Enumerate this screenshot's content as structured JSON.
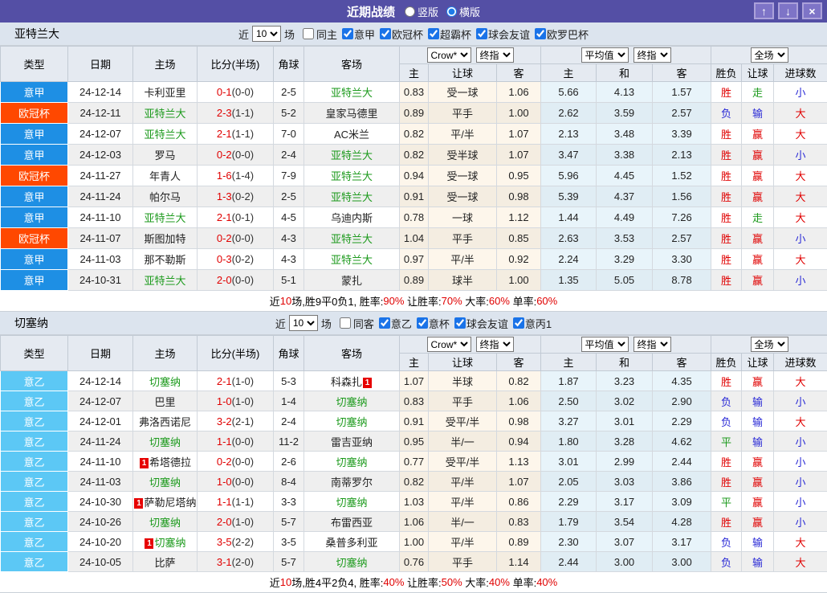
{
  "titlebar": {
    "title": "近期战绩",
    "view_options": [
      {
        "label": "竖版",
        "selected": false
      },
      {
        "label": "横版",
        "selected": true
      }
    ],
    "buttons": {
      "up": "↑",
      "down": "↓",
      "close": "×"
    }
  },
  "colors": {
    "titlebar_bg": "#544fa5",
    "button_bg": "#7e74c7",
    "button_border": "#aba1da",
    "filterbar_bg": "#dce4ee",
    "header_bg": "#e5eaf1",
    "league_blue": "#1e8fe4",
    "league_orange": "#ff4800",
    "league_sky": "#5cc8f5",
    "crow_bg": "#fdf6eb",
    "avg_bg": "#e8f4fa",
    "row_alt": "#efefef",
    "red": "#e00000",
    "green": "#1c9a1c",
    "blue": "#2929d6",
    "team_green": "#1c9a1c",
    "badge_bg": "#e60000"
  },
  "result_colors": {
    "胜": "red",
    "平": "green",
    "负": "blue",
    "赢": "red",
    "走": "green",
    "输": "blue",
    "大": "red",
    "小": "blue"
  },
  "table_header": {
    "cols": [
      "类型",
      "日期",
      "主场",
      "比分(半场)",
      "角球",
      "客场"
    ],
    "odds_groups": [
      {
        "selects": [
          "Crow*",
          "终指"
        ],
        "cols": [
          "主",
          "让球",
          "客"
        ]
      },
      {
        "selects": [
          "平均值",
          "终指"
        ],
        "cols": [
          "主",
          "和",
          "客"
        ]
      },
      {
        "selects": [
          "全场"
        ],
        "cols": [
          "胜负",
          "让球",
          "进球数"
        ]
      }
    ]
  },
  "sections": [
    {
      "team": "亚特兰大",
      "filter": {
        "prefix": "近",
        "count": "10",
        "suffix": "场",
        "venue": {
          "label": "同主",
          "checked": false
        },
        "leagues": [
          {
            "label": "意甲",
            "checked": true
          },
          {
            "label": "欧冠杯",
            "checked": true
          },
          {
            "label": "超霸杯",
            "checked": true
          },
          {
            "label": "球会友谊",
            "checked": true
          },
          {
            "label": "欧罗巴杯",
            "checked": true
          }
        ]
      },
      "rows": [
        {
          "lg": "意甲",
          "lgc": "b",
          "date": "24-12-14",
          "home": {
            "n": "卡利亚里"
          },
          "score": "0-1",
          "half": "(0-0)",
          "cor": "2-5",
          "away": {
            "n": "亚特兰大",
            "hl": true
          },
          "o1": [
            "0.83",
            "受一球",
            "1.06"
          ],
          "o2": [
            "5.66",
            "4.13",
            "1.57"
          ],
          "res": [
            "胜",
            "走",
            "小"
          ]
        },
        {
          "lg": "欧冠杯",
          "lgc": "o",
          "date": "24-12-11",
          "home": {
            "n": "亚特兰大",
            "hl": true
          },
          "score": "2-3",
          "half": "(1-1)",
          "cor": "5-2",
          "away": {
            "n": "皇家马德里"
          },
          "o1": [
            "0.89",
            "平手",
            "1.00"
          ],
          "o2": [
            "2.62",
            "3.59",
            "2.57"
          ],
          "res": [
            "负",
            "输",
            "大"
          ]
        },
        {
          "lg": "意甲",
          "lgc": "b",
          "date": "24-12-07",
          "home": {
            "n": "亚特兰大",
            "hl": true
          },
          "score": "2-1",
          "half": "(1-1)",
          "cor": "7-0",
          "away": {
            "n": "AC米兰"
          },
          "o1": [
            "0.82",
            "平/半",
            "1.07"
          ],
          "o2": [
            "2.13",
            "3.48",
            "3.39"
          ],
          "res": [
            "胜",
            "赢",
            "大"
          ]
        },
        {
          "lg": "意甲",
          "lgc": "b",
          "date": "24-12-03",
          "home": {
            "n": "罗马"
          },
          "score": "0-2",
          "half": "(0-0)",
          "cor": "2-4",
          "away": {
            "n": "亚特兰大",
            "hl": true
          },
          "o1": [
            "0.82",
            "受半球",
            "1.07"
          ],
          "o2": [
            "3.47",
            "3.38",
            "2.13"
          ],
          "res": [
            "胜",
            "赢",
            "小"
          ]
        },
        {
          "lg": "欧冠杯",
          "lgc": "o",
          "date": "24-11-27",
          "home": {
            "n": "年青人"
          },
          "score": "1-6",
          "half": "(1-4)",
          "cor": "7-9",
          "away": {
            "n": "亚特兰大",
            "hl": true
          },
          "o1": [
            "0.94",
            "受一球",
            "0.95"
          ],
          "o2": [
            "5.96",
            "4.45",
            "1.52"
          ],
          "res": [
            "胜",
            "赢",
            "大"
          ]
        },
        {
          "lg": "意甲",
          "lgc": "b",
          "date": "24-11-24",
          "home": {
            "n": "帕尔马"
          },
          "score": "1-3",
          "half": "(0-2)",
          "cor": "2-5",
          "away": {
            "n": "亚特兰大",
            "hl": true
          },
          "o1": [
            "0.91",
            "受一球",
            "0.98"
          ],
          "o2": [
            "5.39",
            "4.37",
            "1.56"
          ],
          "res": [
            "胜",
            "赢",
            "大"
          ]
        },
        {
          "lg": "意甲",
          "lgc": "b",
          "date": "24-11-10",
          "home": {
            "n": "亚特兰大",
            "hl": true
          },
          "score": "2-1",
          "half": "(0-1)",
          "cor": "4-5",
          "away": {
            "n": "乌迪内斯"
          },
          "o1": [
            "0.78",
            "一球",
            "1.12"
          ],
          "o2": [
            "1.44",
            "4.49",
            "7.26"
          ],
          "res": [
            "胜",
            "走",
            "大"
          ]
        },
        {
          "lg": "欧冠杯",
          "lgc": "o",
          "date": "24-11-07",
          "home": {
            "n": "斯图加特"
          },
          "score": "0-2",
          "half": "(0-0)",
          "cor": "4-3",
          "away": {
            "n": "亚特兰大",
            "hl": true
          },
          "o1": [
            "1.04",
            "平手",
            "0.85"
          ],
          "o2": [
            "2.63",
            "3.53",
            "2.57"
          ],
          "res": [
            "胜",
            "赢",
            "小"
          ]
        },
        {
          "lg": "意甲",
          "lgc": "b",
          "date": "24-11-03",
          "home": {
            "n": "那不勒斯"
          },
          "score": "0-3",
          "half": "(0-2)",
          "cor": "4-3",
          "away": {
            "n": "亚特兰大",
            "hl": true
          },
          "o1": [
            "0.97",
            "平/半",
            "0.92"
          ],
          "o2": [
            "2.24",
            "3.29",
            "3.30"
          ],
          "res": [
            "胜",
            "赢",
            "大"
          ]
        },
        {
          "lg": "意甲",
          "lgc": "b",
          "date": "24-10-31",
          "home": {
            "n": "亚特兰大",
            "hl": true
          },
          "score": "2-0",
          "half": "(0-0)",
          "cor": "5-1",
          "away": {
            "n": "蒙扎"
          },
          "o1": [
            "0.89",
            "球半",
            "1.00"
          ],
          "o2": [
            "1.35",
            "5.05",
            "8.78"
          ],
          "res": [
            "胜",
            "赢",
            "小"
          ]
        }
      ],
      "summary": [
        {
          "t": "近"
        },
        {
          "t": "10",
          "r": 1
        },
        {
          "t": "场,胜9平0负1, 胜率:"
        },
        {
          "t": "90%",
          "r": 1
        },
        {
          "t": " 让胜率:"
        },
        {
          "t": "70%",
          "r": 1
        },
        {
          "t": " 大率:"
        },
        {
          "t": "60%",
          "r": 1
        },
        {
          "t": " 单率:"
        },
        {
          "t": "60%",
          "r": 1
        }
      ]
    },
    {
      "team": "切塞纳",
      "filter": {
        "prefix": "近",
        "count": "10",
        "suffix": "场",
        "venue": {
          "label": "同客",
          "checked": false
        },
        "leagues": [
          {
            "label": "意乙",
            "checked": true
          },
          {
            "label": "意杯",
            "checked": true
          },
          {
            "label": "球会友谊",
            "checked": true
          },
          {
            "label": "意丙1",
            "checked": true
          }
        ]
      },
      "rows": [
        {
          "lg": "意乙",
          "lgc": "s",
          "date": "24-12-14",
          "home": {
            "n": "切塞纳",
            "hl": true
          },
          "score": "2-1",
          "half": "(1-0)",
          "cor": "5-3",
          "away": {
            "n": "科森扎",
            "ba": "1"
          },
          "o1": [
            "1.07",
            "半球",
            "0.82"
          ],
          "o2": [
            "1.87",
            "3.23",
            "4.35"
          ],
          "res": [
            "胜",
            "赢",
            "大"
          ]
        },
        {
          "lg": "意乙",
          "lgc": "s",
          "date": "24-12-07",
          "home": {
            "n": "巴里"
          },
          "score": "1-0",
          "half": "(1-0)",
          "cor": "1-4",
          "away": {
            "n": "切塞纳",
            "hl": true
          },
          "o1": [
            "0.83",
            "平手",
            "1.06"
          ],
          "o2": [
            "2.50",
            "3.02",
            "2.90"
          ],
          "res": [
            "负",
            "输",
            "小"
          ]
        },
        {
          "lg": "意乙",
          "lgc": "s",
          "date": "24-12-01",
          "home": {
            "n": "弗洛西诺尼"
          },
          "score": "3-2",
          "half": "(2-1)",
          "cor": "2-4",
          "away": {
            "n": "切塞纳",
            "hl": true
          },
          "o1": [
            "0.91",
            "受平/半",
            "0.98"
          ],
          "o2": [
            "3.27",
            "3.01",
            "2.29"
          ],
          "res": [
            "负",
            "输",
            "大"
          ]
        },
        {
          "lg": "意乙",
          "lgc": "s",
          "date": "24-11-24",
          "home": {
            "n": "切塞纳",
            "hl": true
          },
          "score": "1-1",
          "half": "(0-0)",
          "cor": "11-2",
          "away": {
            "n": "雷吉亚纳"
          },
          "o1": [
            "0.95",
            "半/一",
            "0.94"
          ],
          "o2": [
            "1.80",
            "3.28",
            "4.62"
          ],
          "res": [
            "平",
            "输",
            "小"
          ]
        },
        {
          "lg": "意乙",
          "lgc": "s",
          "date": "24-11-10",
          "home": {
            "n": "希塔德拉",
            "bb": "1"
          },
          "score": "0-2",
          "half": "(0-0)",
          "cor": "2-6",
          "away": {
            "n": "切塞纳",
            "hl": true
          },
          "o1": [
            "0.77",
            "受平/半",
            "1.13"
          ],
          "o2": [
            "3.01",
            "2.99",
            "2.44"
          ],
          "res": [
            "胜",
            "赢",
            "小"
          ]
        },
        {
          "lg": "意乙",
          "lgc": "s",
          "date": "24-11-03",
          "home": {
            "n": "切塞纳",
            "hl": true
          },
          "score": "1-0",
          "half": "(0-0)",
          "cor": "8-4",
          "away": {
            "n": "南蒂罗尔"
          },
          "o1": [
            "0.82",
            "平/半",
            "1.07"
          ],
          "o2": [
            "2.05",
            "3.03",
            "3.86"
          ],
          "res": [
            "胜",
            "赢",
            "小"
          ]
        },
        {
          "lg": "意乙",
          "lgc": "s",
          "date": "24-10-30",
          "home": {
            "n": "萨勒尼塔纳",
            "bb": "1"
          },
          "score": "1-1",
          "half": "(1-1)",
          "cor": "3-3",
          "away": {
            "n": "切塞纳",
            "hl": true
          },
          "o1": [
            "1.03",
            "平/半",
            "0.86"
          ],
          "o2": [
            "2.29",
            "3.17",
            "3.09"
          ],
          "res": [
            "平",
            "赢",
            "小"
          ]
        },
        {
          "lg": "意乙",
          "lgc": "s",
          "date": "24-10-26",
          "home": {
            "n": "切塞纳",
            "hl": true
          },
          "score": "2-0",
          "half": "(1-0)",
          "cor": "5-7",
          "away": {
            "n": "布雷西亚"
          },
          "o1": [
            "1.06",
            "半/一",
            "0.83"
          ],
          "o2": [
            "1.79",
            "3.54",
            "4.28"
          ],
          "res": [
            "胜",
            "赢",
            "小"
          ]
        },
        {
          "lg": "意乙",
          "lgc": "s",
          "date": "24-10-20",
          "home": {
            "n": "切塞纳",
            "hl": true,
            "bb": "1"
          },
          "score": "3-5",
          "half": "(2-2)",
          "cor": "3-5",
          "away": {
            "n": "桑普多利亚"
          },
          "o1": [
            "1.00",
            "平/半",
            "0.89"
          ],
          "o2": [
            "2.30",
            "3.07",
            "3.17"
          ],
          "res": [
            "负",
            "输",
            "大"
          ]
        },
        {
          "lg": "意乙",
          "lgc": "s",
          "date": "24-10-05",
          "home": {
            "n": "比萨"
          },
          "score": "3-1",
          "half": "(2-0)",
          "cor": "5-7",
          "away": {
            "n": "切塞纳",
            "hl": true
          },
          "o1": [
            "0.76",
            "平手",
            "1.14"
          ],
          "o2": [
            "2.44",
            "3.00",
            "3.00"
          ],
          "res": [
            "负",
            "输",
            "大"
          ]
        }
      ],
      "summary": [
        {
          "t": "近"
        },
        {
          "t": "10",
          "r": 1
        },
        {
          "t": "场,胜4平2负4, 胜率:"
        },
        {
          "t": "40%",
          "r": 1
        },
        {
          "t": " 让胜率:"
        },
        {
          "t": "50%",
          "r": 1
        },
        {
          "t": " 大率:"
        },
        {
          "t": "40%",
          "r": 1
        },
        {
          "t": " 单率:"
        },
        {
          "t": "40%",
          "r": 1
        }
      ]
    }
  ]
}
